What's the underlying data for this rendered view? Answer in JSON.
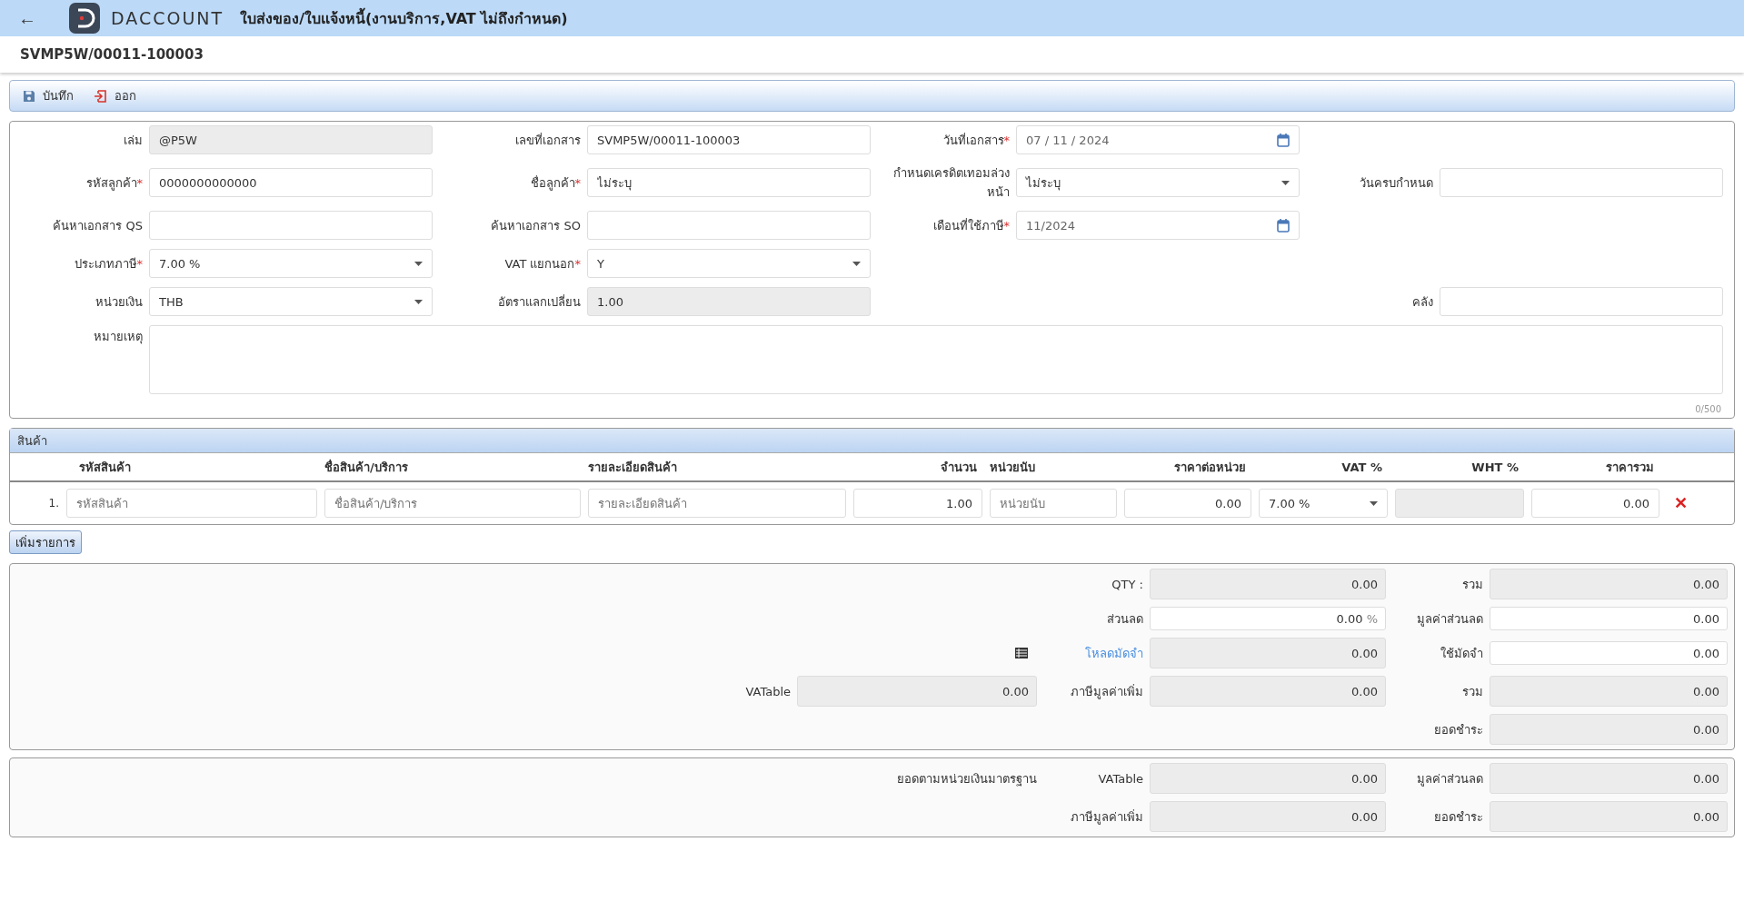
{
  "header": {
    "back": "←",
    "logo_text": "DACCOUNT",
    "title": "ใบส่งของ/ใบแจ้งหนี้(งานบริการ,VAT ไม่ถึงกำหนด)"
  },
  "document_number": "SVMP5W/00011-100003",
  "toolbar": [
    {
      "label": "บันทึก",
      "kind": "save"
    },
    {
      "label": "ออก",
      "kind": "exit"
    }
  ],
  "form": {
    "rows": [
      [
        {
          "kind": "text",
          "label": "เล่ม",
          "value": "@P5W",
          "readonly": true,
          "required": false
        },
        {
          "kind": "text",
          "label": "เลขที่เอกสาร",
          "value": "SVMP5W/00011-100003",
          "readonly": false,
          "required": false
        },
        {
          "kind": "date",
          "label": "วันที่เอกสาร",
          "value": "07 / 11 /  2024",
          "readonly": false,
          "required": true
        },
        {
          "kind": "blank"
        }
      ],
      [
        {
          "kind": "text",
          "label": "รหัสลูกค้า",
          "value": "0000000000000",
          "readonly": false,
          "required": true
        },
        {
          "kind": "text",
          "label": "ชื่อลูกค้า",
          "value": "ไม่ระบุ",
          "readonly": false,
          "required": true
        },
        {
          "kind": "select",
          "label": "กำหนดเครดิตเทอมล่วงหน้า",
          "value": "ไม่ระบุ",
          "readonly": false,
          "required": false
        },
        {
          "kind": "text",
          "label": "วันครบกำหนด",
          "readonly": false,
          "required": false
        }
      ],
      [
        {
          "kind": "text",
          "label": "ค้นหาเอกสาร QS",
          "readonly": false,
          "required": false
        },
        {
          "kind": "text",
          "label": "ค้นหาเอกสาร SO",
          "readonly": false,
          "required": false
        },
        {
          "kind": "date",
          "label": "เดือนที่ใช้ภาษี",
          "value": "11/2024",
          "readonly": false,
          "required": true
        },
        {
          "kind": "blank"
        }
      ],
      [
        {
          "kind": "select",
          "label": "ประเภทภาษี",
          "value": "7.00 %",
          "readonly": false,
          "required": true
        },
        {
          "kind": "select",
          "label": "VAT แยกนอก",
          "value": "Y",
          "readonly": false,
          "required": true
        },
        {
          "kind": "blank"
        },
        {
          "kind": "blank"
        }
      ],
      [
        {
          "kind": "select",
          "label": "หน่วยเงิน",
          "value": "THB",
          "readonly": false,
          "required": false
        },
        {
          "kind": "text",
          "label": "อัตราแลกเปลี่ยน",
          "value": "1.00",
          "readonly": true,
          "required": false
        },
        {
          "kind": "blank"
        },
        {
          "kind": "text",
          "label": "คลัง",
          "readonly": false,
          "required": false
        }
      ]
    ],
    "required_mark": "*",
    "remark": {
      "label": "หมายเหตุ",
      "counter": "0/500"
    }
  },
  "items": {
    "title": "สินค้า",
    "columns": [
      "รหัสสินค้า",
      "ชื่อสินค้า/บริการ",
      "รายละเอียดสินค้า",
      "จำนวน",
      "หน่วยนับ",
      "ราคาต่อหน่วย",
      "VAT %",
      "WHT %",
      "ราคารวม"
    ],
    "rows": [
      {
        "index": "1.",
        "cells": [
          {
            "kind": "text",
            "placeholder": "รหัสสินค้า"
          },
          {
            "kind": "text",
            "placeholder": "ชื่อสินค้า/บริการ"
          },
          {
            "kind": "text",
            "placeholder": "รายละเอียดสินค้า"
          },
          {
            "kind": "number",
            "value": "1.00"
          },
          {
            "kind": "text",
            "placeholder": "หน่วยนับ"
          },
          {
            "kind": "number",
            "value": "0.00"
          },
          {
            "kind": "select",
            "value": "7.00 %"
          },
          {
            "kind": "readonly"
          },
          {
            "kind": "number",
            "value": "0.00"
          }
        ],
        "delete": "✕"
      }
    ],
    "add_button": "เพิ่มรายการ"
  },
  "totals": [
    [
      {
        "kind": "blank"
      },
      {
        "kind": "field",
        "label": "QTY :",
        "value": "0.00",
        "readonly": true
      },
      {
        "kind": "field",
        "label": "รวม",
        "value": "0.00",
        "readonly": true
      }
    ],
    [
      {
        "kind": "blank"
      },
      {
        "kind": "field",
        "label": "ส่วนลด",
        "value": "0.00",
        "suffix": "%",
        "readonly": false
      },
      {
        "kind": "field",
        "label": "มูลค่าส่วนลด",
        "value": "0.00",
        "readonly": false
      }
    ],
    [
      {
        "kind": "icon"
      },
      {
        "kind": "field",
        "label": "โหลดมัดจำ",
        "value": "0.00",
        "readonly": true,
        "link": true
      },
      {
        "kind": "field",
        "label": "ใช้มัดจำ",
        "value": "0.00",
        "readonly": false
      }
    ],
    [
      {
        "kind": "field",
        "label": "VATable",
        "value": "0.00",
        "readonly": true
      },
      {
        "kind": "field",
        "label": "ภาษีมูลค่าเพิ่ม",
        "value": "0.00",
        "readonly": true
      },
      {
        "kind": "field",
        "label": "รวม",
        "value": "0.00",
        "readonly": true
      }
    ],
    [
      {
        "kind": "blank"
      },
      {
        "kind": "blank"
      },
      {
        "kind": "field",
        "label": "ยอดชำระ",
        "value": "0.00",
        "readonly": true
      }
    ]
  ],
  "standard_totals": [
    [
      {
        "kind": "note",
        "text": "ยอดตามหน่วยเงินมาตรฐาน"
      },
      {
        "kind": "field",
        "label": "VATable",
        "value": "0.00",
        "readonly": true
      },
      {
        "kind": "field",
        "label": "มูลค่าส่วนลด",
        "value": "0.00",
        "readonly": true
      }
    ],
    [
      {
        "kind": "blank"
      },
      {
        "kind": "field",
        "label": "ภาษีมูลค่าเพิ่ม",
        "value": "0.00",
        "readonly": true
      },
      {
        "kind": "field",
        "label": "ยอดชำระ",
        "value": "0.00",
        "readonly": true
      }
    ]
  ]
}
